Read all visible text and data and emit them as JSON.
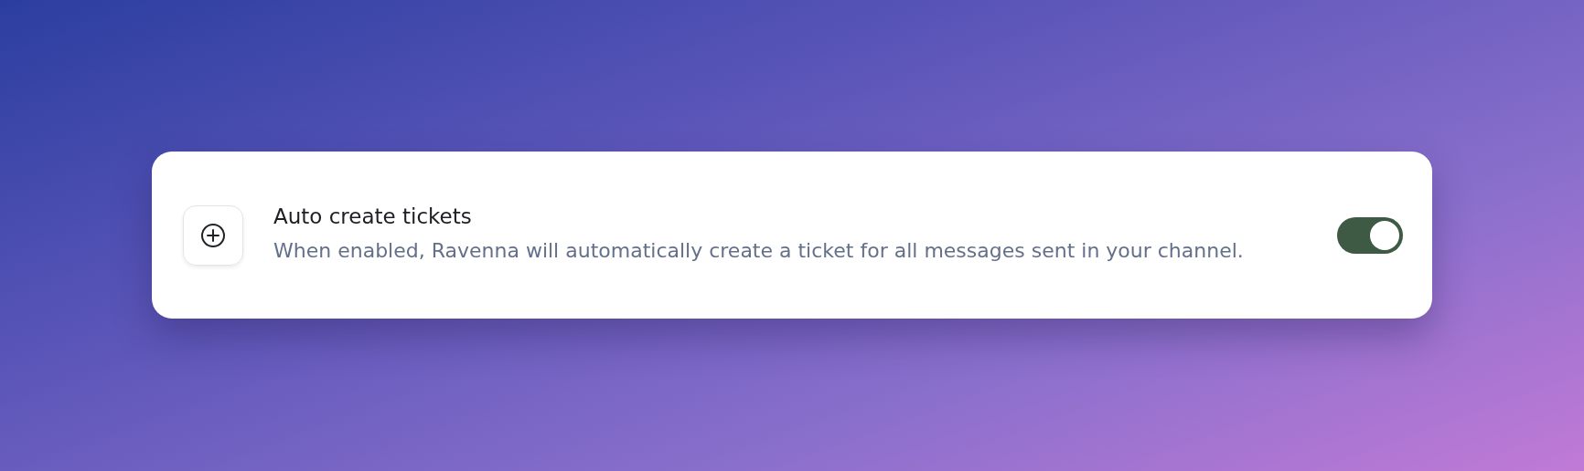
{
  "setting": {
    "title": "Auto create tickets",
    "description": "When enabled, Ravenna will automatically create a ticket for all messages sent in your channel.",
    "toggle": {
      "on": true
    }
  }
}
